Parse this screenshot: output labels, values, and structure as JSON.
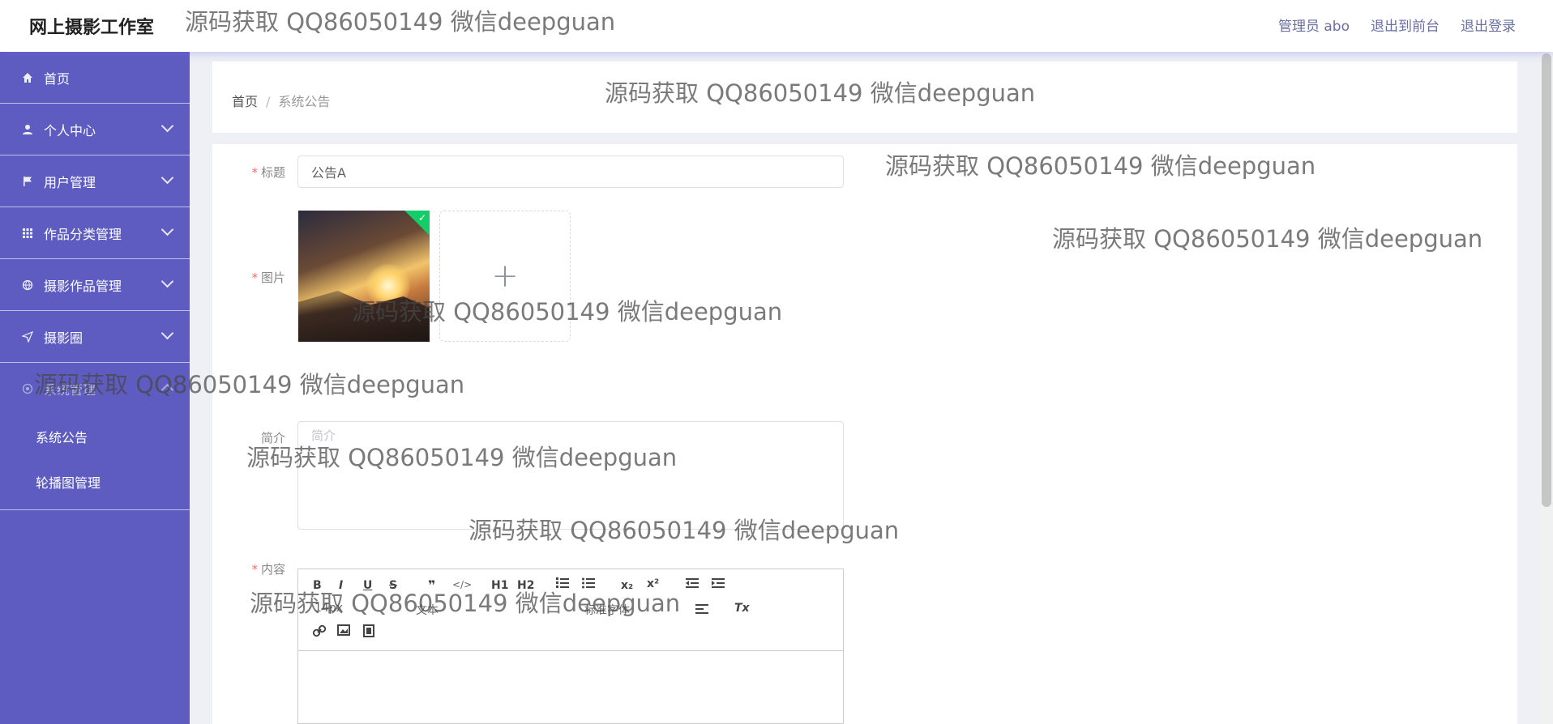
{
  "header": {
    "app_title": "网上摄影工作室",
    "user_label": "管理员 abo",
    "front_link": "退出到前台",
    "logout_link": "退出登录"
  },
  "sidebar": {
    "items": [
      {
        "label": "首页",
        "icon": "home-icon"
      },
      {
        "label": "个人中心",
        "icon": "user-icon"
      },
      {
        "label": "用户管理",
        "icon": "flag-icon"
      },
      {
        "label": "作品分类管理",
        "icon": "grid-icon"
      },
      {
        "label": "摄影作品管理",
        "icon": "globe-icon"
      },
      {
        "label": "摄影圈",
        "icon": "send-icon"
      },
      {
        "label": "系统管理",
        "icon": "settings-icon"
      }
    ],
    "sub_items": [
      {
        "label": "系统公告"
      },
      {
        "label": "轮播图管理"
      }
    ]
  },
  "breadcrumb": {
    "home": "首页",
    "separator": "/",
    "current": "系统公告"
  },
  "form": {
    "title_label": "标题",
    "title_value": "公告A",
    "image_label": "图片",
    "upload_plus": "+",
    "intro_label": "简介",
    "intro_placeholder": "简介",
    "content_label": "内容",
    "required_mark": "*",
    "toolbar": {
      "bold": "B",
      "italic": "I",
      "underline": "U",
      "strike": "S",
      "quote": "❞",
      "code": "</>",
      "h1": "H1",
      "h2": "H2",
      "sub": "x₂",
      "sup": "x²",
      "size": "14px",
      "font": "文本",
      "align_font": "标准字体",
      "clear": "Tx"
    }
  },
  "watermark": "源码获取 QQ86050149 微信deepguan",
  "colors": {
    "sidebar_bg": "#5e5cc0",
    "accent": "#6a6fa0",
    "success_badge": "#13ce66",
    "required": "#f56c6c"
  }
}
